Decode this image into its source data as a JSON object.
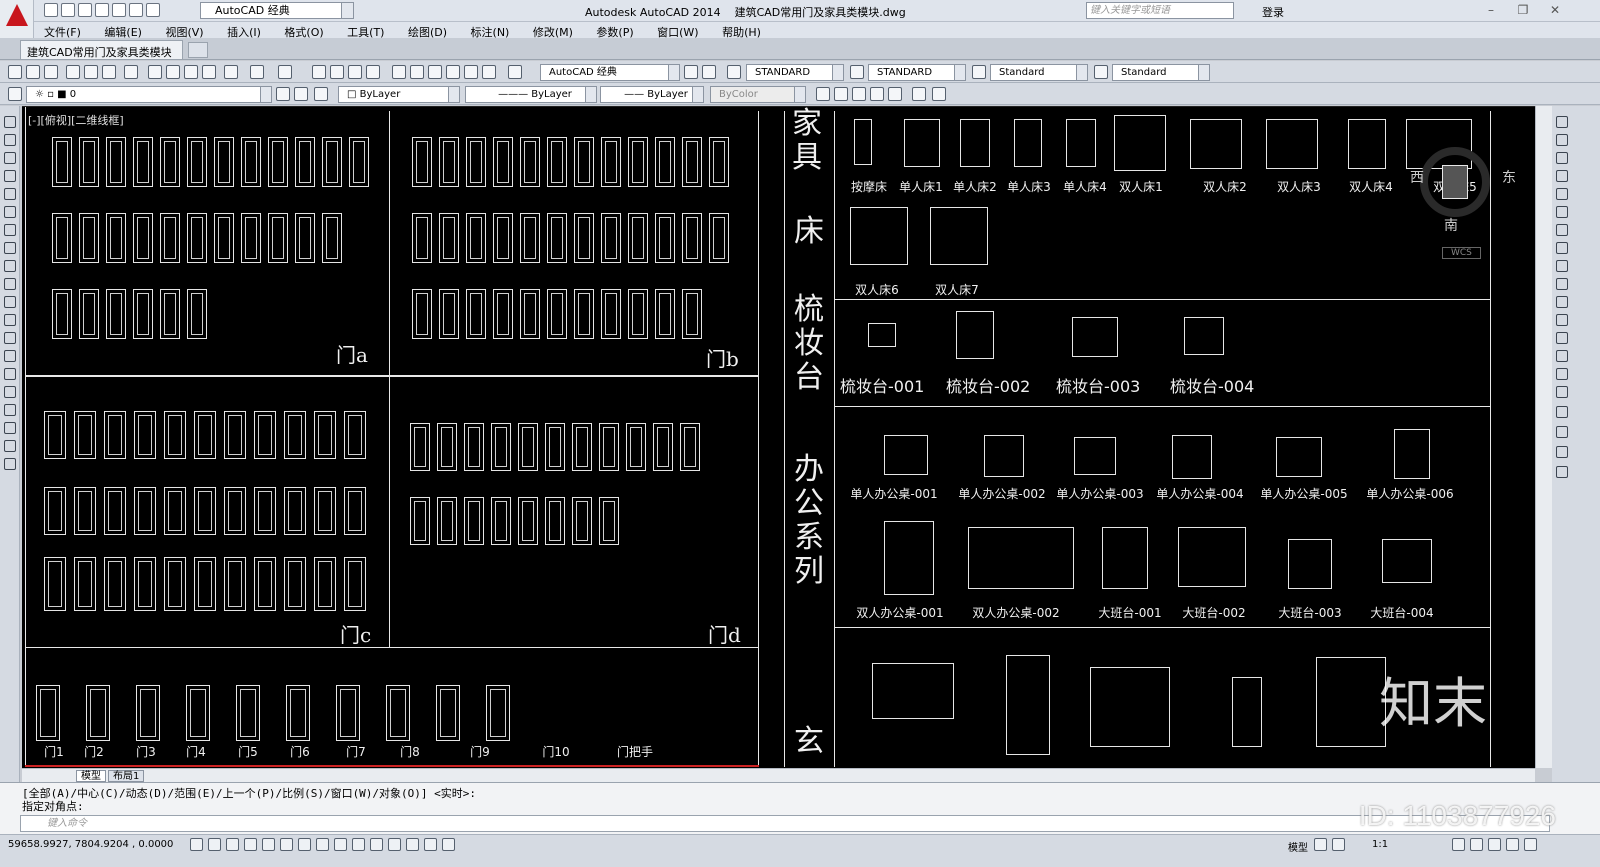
{
  "title_bar": {
    "workspace": "AutoCAD 经典",
    "app_title": "Autodesk AutoCAD 2014",
    "file_name": "建筑CAD常用门及家具类模块.dwg",
    "search_placeholder": "键入关键字或短语",
    "login": "登录"
  },
  "menu": [
    "文件(F)",
    "编辑(E)",
    "视图(V)",
    "插入(I)",
    "格式(O)",
    "工具(T)",
    "绘图(D)",
    "标注(N)",
    "修改(M)",
    "参数(P)",
    "窗口(W)",
    "帮助(H)"
  ],
  "doc_tab": "建筑CAD常用门及家具类模块*",
  "toolbar1": {
    "workspace_combo": "AutoCAD 经典",
    "text_style": "STANDARD",
    "dim_style": "STANDARD",
    "table_style": "Standard",
    "mleader_style": "Standard"
  },
  "toolbar2": {
    "layer": "0",
    "color": "ByLayer",
    "linetype": "ByLayer",
    "lineweight": "ByLayer",
    "plotstyle": "ByColor"
  },
  "viewport_label": "[-][俯视][二维线框]",
  "door_sections": [
    "门a",
    "门b",
    "门c",
    "门d"
  ],
  "door_singles": [
    "门1",
    "门2",
    "门3",
    "门4",
    "门5",
    "门6",
    "门7",
    "门8",
    "门9",
    "门10",
    "门把手"
  ],
  "vertical_titles": {
    "furniture": "家具",
    "bed": "床",
    "dresser": "梳妆台",
    "office": "办公系列",
    "entry": "玄"
  },
  "beds_row1": [
    "按摩床",
    "单人床1",
    "单人床2",
    "单人床3",
    "单人床4",
    "双人床1",
    "双人床2",
    "双人床3",
    "双人床4",
    "双人床5"
  ],
  "beds_row2": [
    "双人床6",
    "双人床7"
  ],
  "dressers": [
    "梳妆台-001",
    "梳妆台-002",
    "梳妆台-003",
    "梳妆台-004"
  ],
  "desks_row1": [
    "单人办公桌-001",
    "单人办公桌-002",
    "单人办公桌-003",
    "单人办公桌-004",
    "单人办公桌-005",
    "单人办公桌-006"
  ],
  "desks_row2": [
    "双人办公桌-001",
    "双人办公桌-002",
    "大班台-001",
    "大班台-002",
    "大班台-003",
    "大班台-004"
  ],
  "compass": {
    "east": "东",
    "west": "西",
    "south": "南",
    "wcs": "WCS"
  },
  "layout_tabs": [
    "模型",
    "布局1"
  ],
  "command": {
    "line1": "[全部(A)/中心(C)/动态(D)/范围(E)/上一个(P)/比例(S)/窗口(W)/对象(O)] <实时>:",
    "line2": "指定对角点:",
    "placeholder": "键入命令"
  },
  "status": {
    "coords": "59658.9927, 7804.9204 , 0.0000",
    "model": "模型",
    "scale": "1:1"
  },
  "watermark": {
    "logo": "知末",
    "id": "ID: 1103877926"
  }
}
